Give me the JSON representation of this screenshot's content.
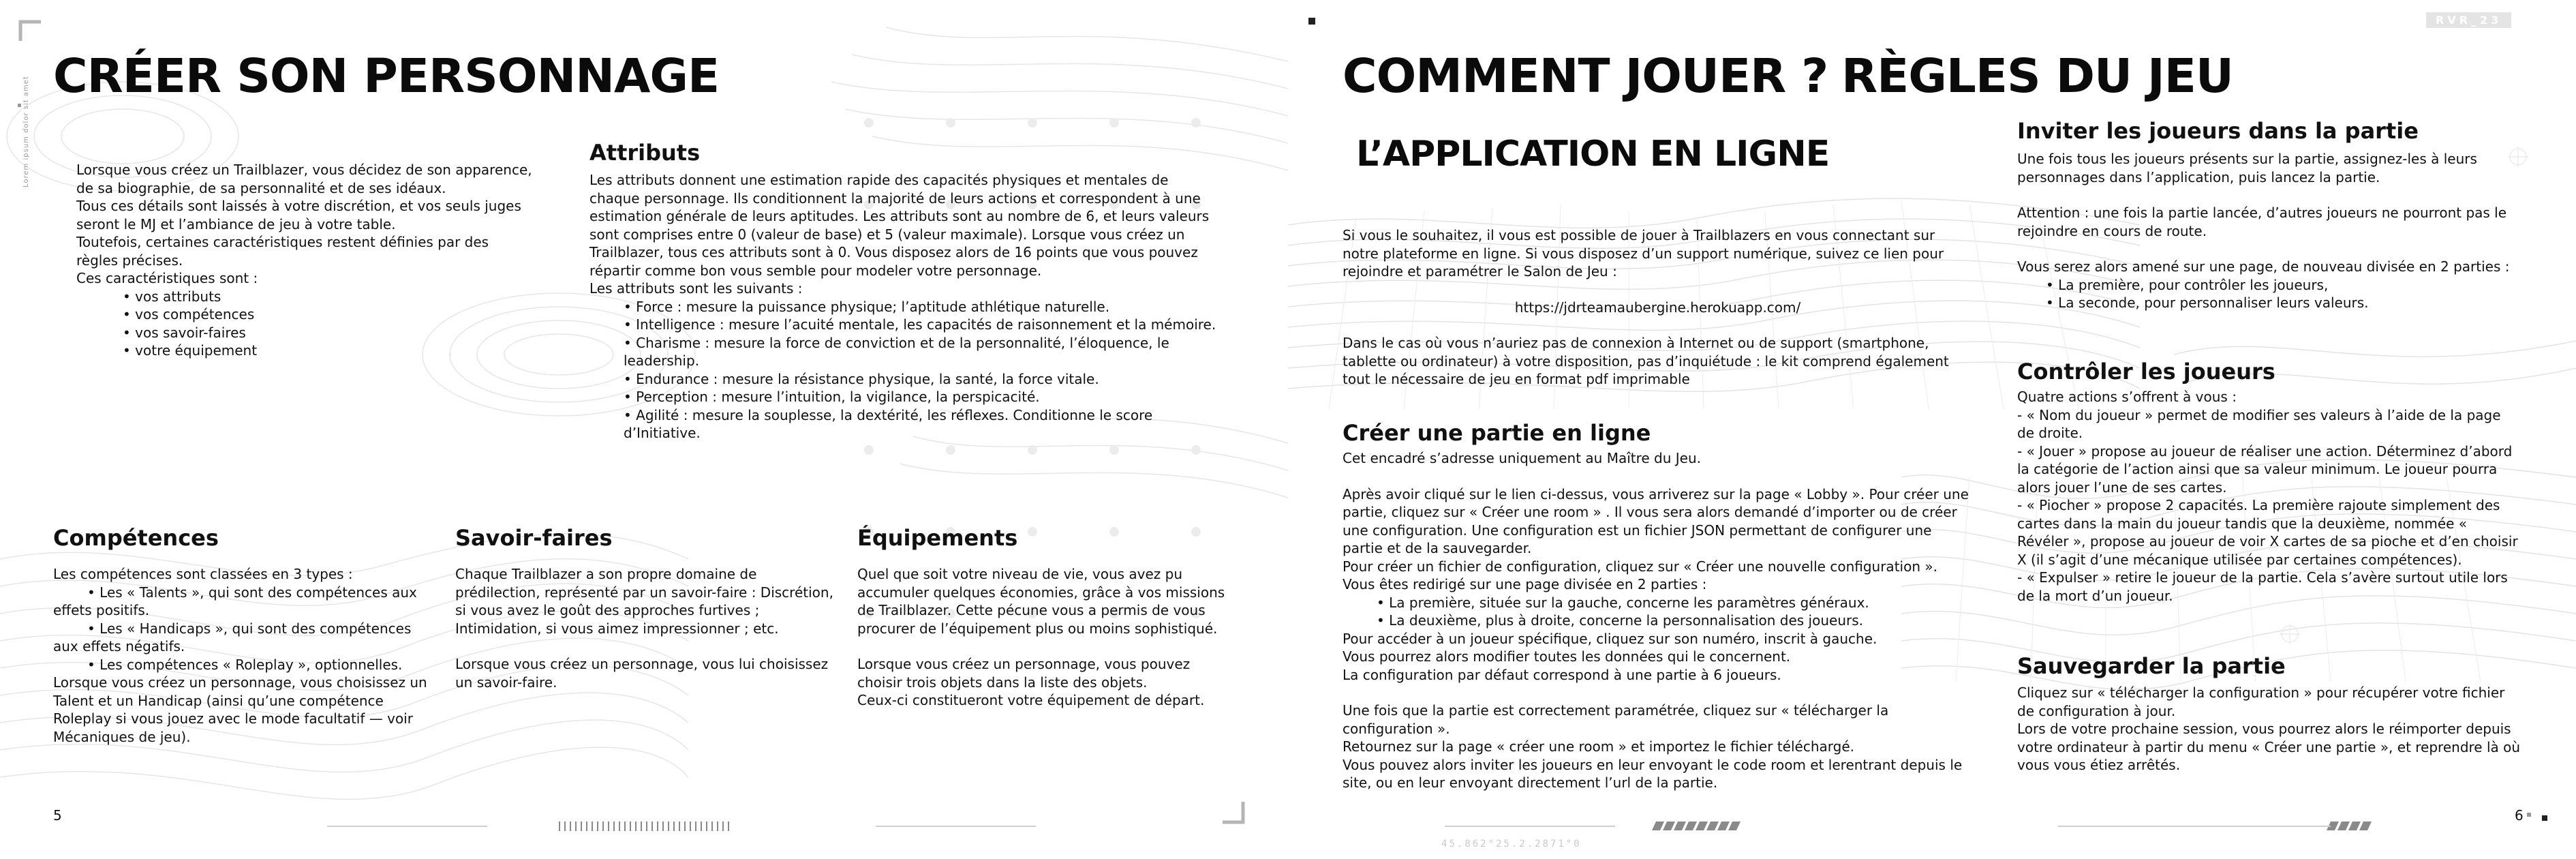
{
  "left": {
    "title": "CRÉER SON PERSONNAGE",
    "side_tag": "Lorem ipsum dolor sit amet",
    "intro": [
      {
        "text": "Lorsque vous créez un Trailblazer, vous décidez de son apparence, de sa biographie, de sa personnalité et de ses idéaux.",
        "kind": "p"
      },
      {
        "text": "Tous ces détails sont laissés à votre discrétion, et vos seuls juges seront le MJ et l’ambiance de jeu à votre table.",
        "kind": "p"
      },
      {
        "text": "Toutefois, certaines caractéristiques restent définies par des règles précises.",
        "kind": "p"
      },
      {
        "text": "Ces caractéristiques sont :",
        "kind": "p"
      },
      {
        "text": "• vos attributs",
        "kind": "b"
      },
      {
        "text": "• vos compétences",
        "kind": "b"
      },
      {
        "text": "• vos savoir-faires",
        "kind": "b"
      },
      {
        "text": "• votre équipement",
        "kind": "b"
      }
    ],
    "attributs": {
      "heading": "Attributs",
      "body": [
        {
          "text": "Les attributs donnent une estimation rapide des capacités physiques et mentales de chaque personnage. Ils conditionnent la majorité de leurs actions et correspondent à une estimation générale de leurs aptitudes. Les attributs sont au nombre de 6, et leurs valeurs sont comprises entre 0 (valeur de base) et 5 (valeur maximale). Lorsque vous créez un Trailblazer, tous ces attributs sont à 0. Vous disposez alors de 16 points que vous pouvez répartir comme bon vous semble pour modeler votre personnage.",
          "kind": "p"
        },
        {
          "text": "Les attributs sont les suivants :",
          "kind": "p"
        },
        {
          "text": "• Force : mesure la puissance physique; l’aptitude athlétique naturelle.",
          "kind": "b"
        },
        {
          "text": "• Intelligence : mesure l’acuité mentale, les capacités de raisonnement et la mémoire.",
          "kind": "b"
        },
        {
          "text": "• Charisme : mesure la force de conviction et de la personnalité, l’éloquence, le leadership.",
          "kind": "b"
        },
        {
          "text": "• Endurance : mesure la résistance physique, la santé, la force vitale.",
          "kind": "b"
        },
        {
          "text": "• Perception : mesure l’intuition, la vigilance, la perspicacité.",
          "kind": "b"
        },
        {
          "text": "• Agilité : mesure la souplesse, la dextérité, les réflexes. Conditionne le score d’Initiative.",
          "kind": "b"
        }
      ]
    },
    "competences": {
      "heading": "Compétences",
      "body": [
        {
          "text": "Les compétences sont classées en 3 types :",
          "kind": "p"
        },
        {
          "text": "• Les « Talents », qui sont des compétences aux effets positifs.",
          "kind": "b"
        },
        {
          "text": "• Les « Handicaps », qui sont des compétences aux effets négatifs.",
          "kind": "b"
        },
        {
          "text": "• Les compétences « Roleplay », optionnelles.",
          "kind": "b"
        },
        {
          "text": "Lorsque vous créez un personnage, vous choisissez un Talent et un Handicap (ainsi qu’une compétence Roleplay si vous jouez avec le mode facultatif — voir Mécaniques de jeu).",
          "kind": "p"
        }
      ]
    },
    "savoir_faires": {
      "heading": "Savoir-faires",
      "body": [
        {
          "text": "Chaque Trailblazer a son propre domaine de prédilection, représenté par un savoir-faire : Discrétion, si vous avez le goût des approches furtives ; Intimidation, si vous aimez impressionner ; etc.",
          "kind": "p"
        },
        {
          "text": "",
          "kind": "blank"
        },
        {
          "text": "Lorsque vous créez un personnage, vous lui choisissez un savoir-faire.",
          "kind": "p"
        }
      ]
    },
    "equipements": {
      "heading": "Équipements",
      "body": [
        {
          "text": "Quel que soit votre niveau de vie, vous avez pu accumuler quelques économies, grâce à vos missions de Trailblazer. Cette pécune vous a permis de vous procurer de l’équipement plus ou moins sophistiqué.",
          "kind": "p"
        },
        {
          "text": "",
          "kind": "blank"
        },
        {
          "text": "Lorsque vous créez un personnage, vous pouvez choisir trois objets dans la liste des objets.",
          "kind": "p"
        },
        {
          "text": "Ceux-ci constitueront votre équipement de départ.",
          "kind": "p"
        }
      ]
    },
    "page_number": "5"
  },
  "right": {
    "title": "COMMENT JOUER ?",
    "title2": "RÈGLES DU JEU",
    "subtitle": "L’APPLICATION EN LIGNE",
    "tag_top": "RVR_23",
    "bottom_code": "45.862°25.2.2871°0",
    "intro": [
      {
        "text": "Si vous le souhaitez, il vous est possible de jouer à Trailblazers en vous connectant sur notre plateforme en ligne. Si vous disposez d’un support numérique, suivez ce lien pour rejoindre et paramétrer le Salon de Jeu :",
        "kind": "p"
      },
      {
        "text": "",
        "kind": "blank"
      },
      {
        "text": "https://jdrteamaubergine.herokuapp.com/",
        "kind": "c"
      },
      {
        "text": "",
        "kind": "blank"
      },
      {
        "text": "Dans le cas où vous n’auriez pas de connexion à Internet ou de support (smartphone, tablette ou ordinateur) à votre disposition, pas d’inquiétude : le kit comprend également tout le nécessaire de jeu en format pdf imprimable",
        "kind": "p"
      }
    ],
    "creer": {
      "heading": "Créer une partie en ligne",
      "body": [
        {
          "text": "Cet encadré s’adresse uniquement au Maître du Jeu.",
          "kind": "p"
        },
        {
          "text": "",
          "kind": "blank"
        },
        {
          "text": "Après avoir cliqué sur le lien ci-dessus, vous arriverez sur la page « Lobby ». Pour créer une partie, cliquez sur « Créer une room » . Il vous sera alors demandé d’importer ou de créer une configuration. Une configuration est un fichier JSON permettant de configurer une partie et de la sauvegarder.",
          "kind": "p"
        },
        {
          "text": "Pour créer un fichier de configuration, cliquez sur « Créer une nouvelle configuration ».",
          "kind": "p"
        },
        {
          "text": "Vous êtes redirigé sur une page divisée en 2 parties :",
          "kind": "p"
        },
        {
          "text": "• La première, située sur la gauche, concerne les paramètres généraux.",
          "kind": "b"
        },
        {
          "text": "• La deuxième, plus à droite, concerne la personnalisation des joueurs.",
          "kind": "b"
        },
        {
          "text": "Pour accéder à un joueur spécifique, cliquez sur son numéro, inscrit à gauche.",
          "kind": "p"
        },
        {
          "text": "Vous pourrez alors modifier toutes les données qui le concernent.",
          "kind": "p"
        },
        {
          "text": "La configuration par défaut correspond à une partie à 6 joueurs.",
          "kind": "p"
        },
        {
          "text": "",
          "kind": "blank"
        },
        {
          "text": "Une fois que la partie est correctement paramétrée, cliquez sur « télécharger la configuration ».",
          "kind": "p"
        },
        {
          "text": "Retournez sur la page « créer une room » et importez le fichier téléchargé.",
          "kind": "p"
        },
        {
          "text": "Vous pouvez alors inviter les joueurs en leur envoyant le code room et lerentrant depuis le site, ou en leur envoyant directement l’url de la partie.",
          "kind": "p"
        }
      ]
    },
    "inviter": {
      "heading": "Inviter les joueurs dans la partie",
      "body": [
        {
          "text": "Une fois tous les joueurs présents sur la partie, assignez-les à leurs personnages dans l’application, puis lancez la partie.",
          "kind": "p"
        },
        {
          "text": "",
          "kind": "blank"
        },
        {
          "text": "Attention : une fois la partie lancée, d’autres joueurs ne pourront pas le rejoindre en cours de route.",
          "kind": "p"
        },
        {
          "text": "",
          "kind": "blank"
        },
        {
          "text": "Vous serez alors amené sur une page, de nouveau divisée en 2 parties :",
          "kind": "p"
        },
        {
          "text": "• La première, pour contrôler les joueurs,",
          "kind": "b"
        },
        {
          "text": "• La seconde, pour personnaliser leurs valeurs.",
          "kind": "b"
        }
      ]
    },
    "controler": {
      "heading": "Contrôler les joueurs",
      "body": [
        {
          "text": "Quatre actions s’offrent à vous :",
          "kind": "p"
        },
        {
          "text": "- « Nom du joueur » permet de modifier ses valeurs à l’aide de la page de droite.",
          "kind": "p"
        },
        {
          "text": "- « Jouer » propose au joueur de réaliser une action. Déterminez d’abord la catégorie de l’action ainsi que sa valeur minimum. Le joueur pourra alors jouer l’une de ses cartes.",
          "kind": "p"
        },
        {
          "text": "- « Piocher » propose 2 capacités. La première rajoute simplement des cartes dans la main du joueur tandis que la deuxième, nommée « Révéler », propose au joueur de voir X cartes de sa pioche et d’en choisir X (il s’agit d’une mécanique utilisée par certaines compétences).",
          "kind": "p"
        },
        {
          "text": "- « Expulser » retire le joueur de la partie. Cela s’avère surtout utile lors de la mort d’un joueur.",
          "kind": "p"
        }
      ]
    },
    "sauvegarder": {
      "heading": "Sauvegarder la partie",
      "body": [
        {
          "text": "Cliquez sur « télécharger la configuration » pour récupérer votre fichier de configuration à jour.",
          "kind": "p"
        },
        {
          "text": "Lors de votre prochaine session, vous pourrez alors le réimporter depuis votre ordinateur à partir du menu « Créer une partie », et reprendre là où vous vous étiez arrêtés.",
          "kind": "p"
        }
      ]
    },
    "page_number": "6"
  }
}
